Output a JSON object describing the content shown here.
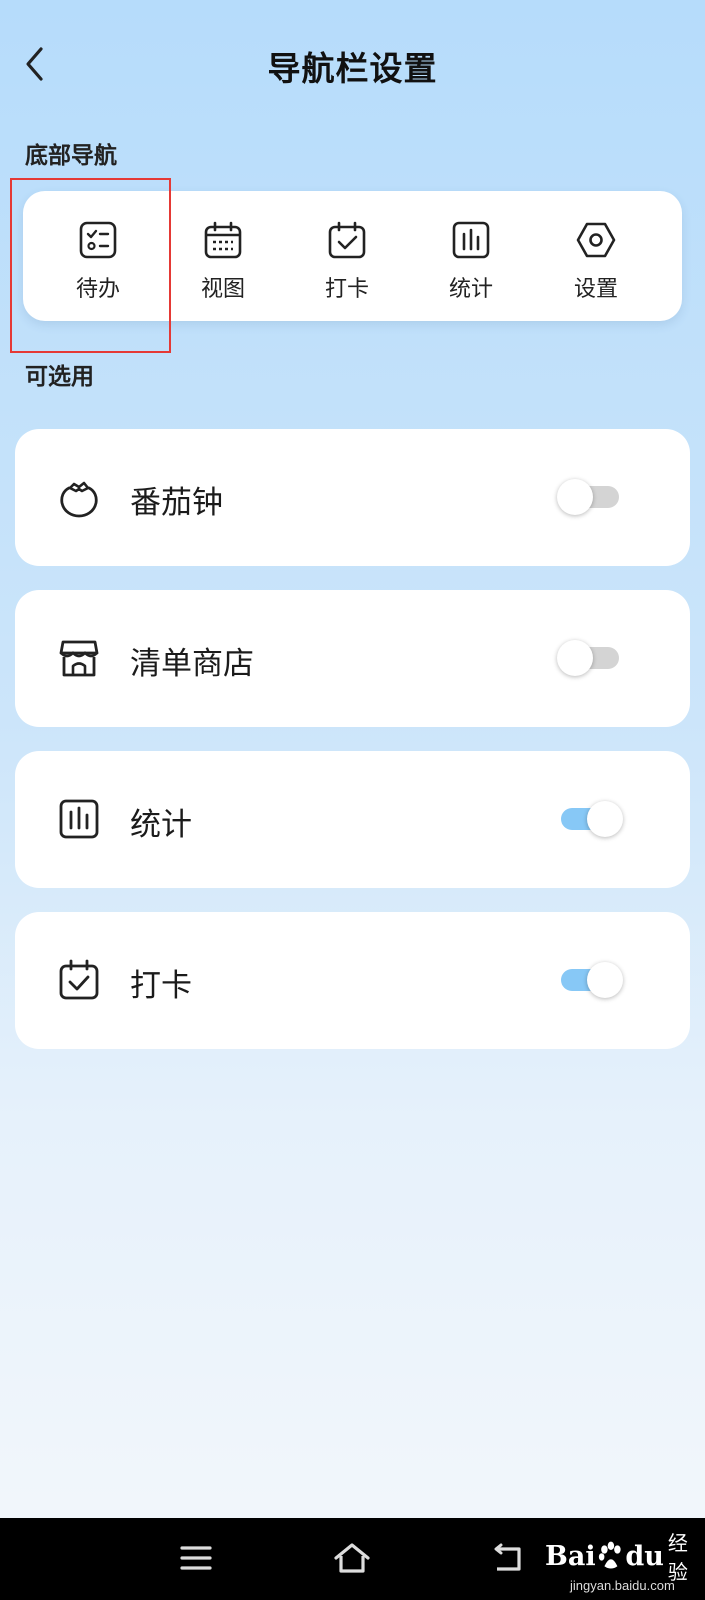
{
  "header": {
    "title": "导航栏设置",
    "back_icon": "chevron-left-icon"
  },
  "bottom_nav": {
    "section_title": "底部导航",
    "items": [
      {
        "label": "待办",
        "icon": "todo-list-icon"
      },
      {
        "label": "视图",
        "icon": "calendar-icon"
      },
      {
        "label": "打卡",
        "icon": "calendar-check-icon"
      },
      {
        "label": "统计",
        "icon": "bar-chart-icon"
      },
      {
        "label": "设置",
        "icon": "hexagon-settings-icon"
      }
    ],
    "highlighted_item": "待办",
    "highlight_color": "#e53935"
  },
  "optional": {
    "section_title": "可选用",
    "items": [
      {
        "label": "番茄钟",
        "icon": "tomato-icon",
        "enabled": false
      },
      {
        "label": "清单商店",
        "icon": "store-icon",
        "enabled": false
      },
      {
        "label": "统计",
        "icon": "bar-chart-icon",
        "enabled": true
      },
      {
        "label": "打卡",
        "icon": "calendar-check-icon",
        "enabled": true
      }
    ]
  },
  "system_bar": {
    "buttons": [
      "menu-icon",
      "home-icon",
      "back-arrow-icon"
    ],
    "watermark": {
      "brand_left": "Bai",
      "brand_right": "du",
      "product": "经验",
      "url": "jingyan.baidu.com"
    }
  },
  "colors": {
    "toggle_on": "#87c8f6",
    "toggle_off": "#d4d4d4",
    "background_top": "#b6dcfb",
    "background_bottom": "#f1f6fb"
  }
}
